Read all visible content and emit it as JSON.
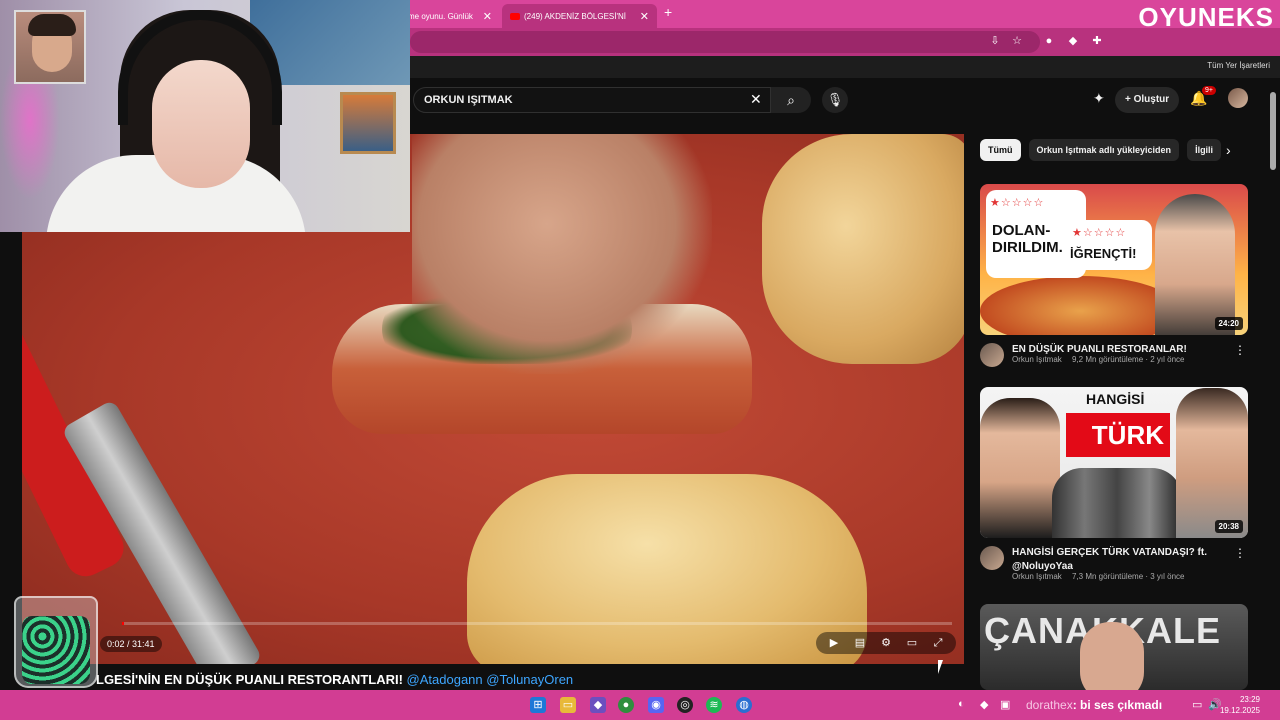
{
  "browser": {
    "tabs": [
      {
        "title": "me oyunu. Günlük",
        "close": "✕"
      },
      {
        "title": "(249) AKDENİZ BÖLGESİ'Nİ",
        "close": "✕"
      }
    ],
    "new_tab": "+",
    "bookmarks_all": "Tüm Yer İşaretleri",
    "brand": "OYUNEKS"
  },
  "youtube": {
    "search_value": "ORKUN IŞITMAK",
    "create_label": "Oluştur",
    "notif_badge": "9+",
    "player": {
      "time": "0:02 / 31:41",
      "progress_fraction": 0.001
    },
    "video_title_visible": "LGESİ'NİN EN DÜŞÜK PUANLI RESTORANTLARI!",
    "mentions": "@Atadogann @TolunayOren",
    "chips": [
      "Tümü",
      "Orkun Işıtmak adlı yükleyiciden",
      "İlgili"
    ],
    "recommendations": [
      {
        "title": "EN DÜŞÜK PUANLI RESTORANLAR!",
        "channel": "Orkun Işıtmak",
        "stats": "9,2 Mn görüntüleme · 2 yıl önce",
        "duration": "24:20",
        "thumb_text_1": "DOLAN-\nDIRILDIM.",
        "thumb_text_2": "İĞRENÇTİ!"
      },
      {
        "title": "HANGİSİ GERÇEK TÜRK VATANDAŞI? ft. @NoluyoYaa",
        "channel": "Orkun Işıtmak",
        "stats": "7,3 Mn görüntüleme · 3 yıl önce",
        "duration": "20:38",
        "thumb_text_1": "HANGİSİ",
        "thumb_text_2": "TÜRK"
      },
      {
        "thumb_text_1": "ÇANAKKALE"
      }
    ]
  },
  "taskbar": {
    "overlay_text_dim": "dorathex",
    "overlay_text": ": bi ses çıkmadı",
    "time": "23:29",
    "date": "19.12.2025"
  }
}
